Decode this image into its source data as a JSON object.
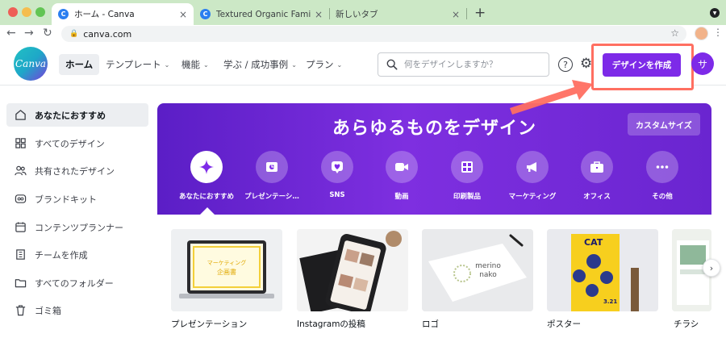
{
  "browser": {
    "tabs": [
      {
        "title": "ホーム - Canva",
        "active": true
      },
      {
        "title": "Textured Organic Family Bondi",
        "active": false
      },
      {
        "title": "新しいタブ",
        "active": false
      }
    ],
    "new_tab_symbol": "+",
    "url": "canva.com"
  },
  "header": {
    "logo_text": "Canva",
    "nav": [
      {
        "label": "ホーム"
      },
      {
        "label": "テンプレート"
      },
      {
        "label": "機能"
      },
      {
        "label": "学ぶ / 成功事例"
      },
      {
        "label": "プラン"
      }
    ],
    "search_placeholder": "何をデザインしますか？",
    "help_symbol": "?",
    "create_button": "デザインを作成",
    "avatar_initial": "サ"
  },
  "sidebar": {
    "items": [
      {
        "label": "あなたにおすすめ",
        "icon": "home-icon",
        "active": true
      },
      {
        "label": "すべてのデザイン",
        "icon": "grid-icon"
      },
      {
        "label": "共有されたデザイン",
        "icon": "people-icon"
      },
      {
        "label": "ブランドキット",
        "icon": "brand-icon"
      },
      {
        "label": "コンテンツプランナー",
        "icon": "calendar-icon"
      },
      {
        "label": "チームを作成",
        "icon": "building-icon"
      },
      {
        "label": "すべてのフォルダー",
        "icon": "folder-icon"
      },
      {
        "label": "ゴミ箱",
        "icon": "trash-icon"
      }
    ]
  },
  "hero": {
    "title": "あらゆるものをデザイン",
    "custom_size": "カスタムサイズ",
    "categories": [
      {
        "label": "あなたにおすすめ",
        "icon": "sparkle-icon",
        "active": true
      },
      {
        "label": "プレゼンテーシ…",
        "icon": "presentation-icon"
      },
      {
        "label": "SNS",
        "icon": "heart-icon"
      },
      {
        "label": "動画",
        "icon": "video-icon"
      },
      {
        "label": "印刷製品",
        "icon": "print-icon"
      },
      {
        "label": "マーケティング",
        "icon": "megaphone-icon"
      },
      {
        "label": "オフィス",
        "icon": "briefcase-icon"
      },
      {
        "label": "その他",
        "icon": "more-icon"
      }
    ]
  },
  "templates": [
    {
      "label": "プレゼンテーション",
      "thumb_lines": [
        "マーケティング",
        "企画書"
      ]
    },
    {
      "label": "Instagramの投稿"
    },
    {
      "label": "ロゴ",
      "thumb_lines": [
        "merino",
        "nako"
      ]
    },
    {
      "label": "ポスター",
      "thumb_lines": [
        "CAT",
        "3.21"
      ]
    },
    {
      "label": "チラシ"
    }
  ],
  "colors": {
    "accent": "#7d2ae8",
    "hero": "#6a25d0",
    "annotation": "#ff6f61"
  }
}
